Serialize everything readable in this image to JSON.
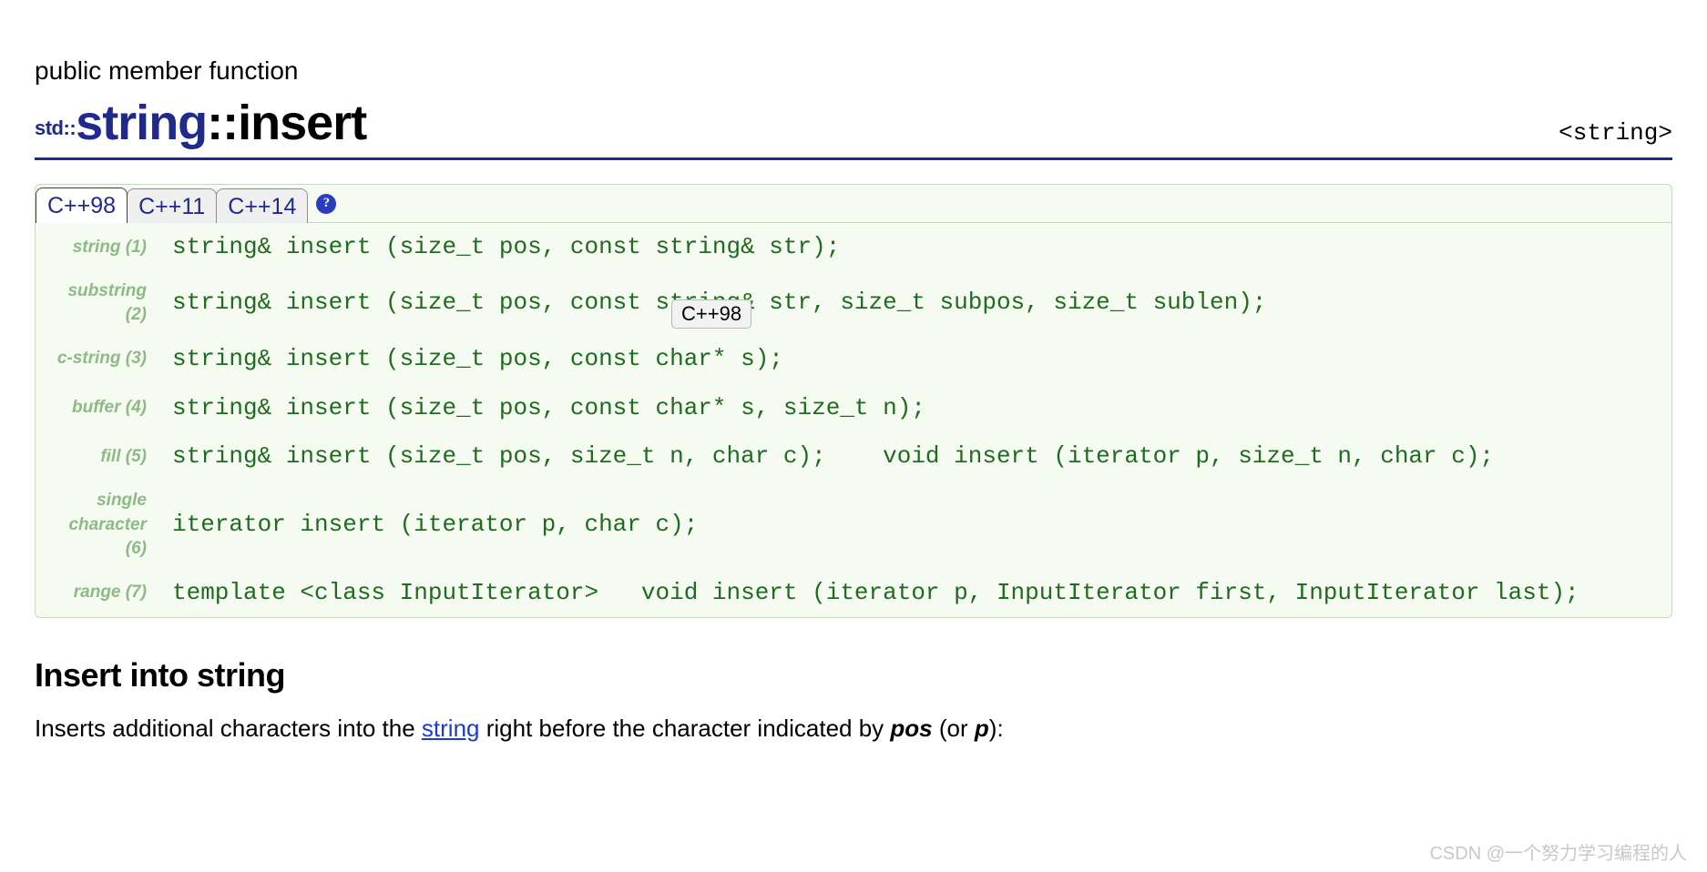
{
  "classification": "public member function",
  "header_tag": "<string>",
  "title": {
    "namespace": "std::",
    "class_name": "string",
    "separator": "::",
    "member": "insert"
  },
  "tabs": [
    "C++98",
    "C++11",
    "C++14"
  ],
  "active_tab_index": 0,
  "help_glyph": "?",
  "tooltip_text": "C++98",
  "overloads": [
    {
      "label": "string (1)",
      "sig": "string& insert (size_t pos, const string& str);"
    },
    {
      "label": "substring (2)",
      "sig": "string& insert (size_t pos, const string& str, size_t subpos, size_t sublen);"
    },
    {
      "label": "c-string (3)",
      "sig": "string& insert (size_t pos, const char* s);"
    },
    {
      "label": "buffer (4)",
      "sig": "string& insert (size_t pos, const char* s, size_t n);"
    },
    {
      "label": "fill (5)",
      "sig": "string& insert (size_t pos, size_t n, char c);    void insert (iterator p, size_t n, char c);"
    },
    {
      "label": "single character (6)",
      "sig": "iterator insert (iterator p, char c);"
    },
    {
      "label": "range (7)",
      "sig": "template <class InputIterator>   void insert (iterator p, InputIterator first, InputIterator last);"
    }
  ],
  "section_heading": "Insert into string",
  "body": {
    "pre": "Inserts additional characters into the ",
    "link_text": "string",
    "mid": " right before the character indicated by ",
    "em1": "pos",
    "between": " (or ",
    "em2": "p",
    "post": "):"
  },
  "watermark": "CSDN @一个努力学习编程的人"
}
